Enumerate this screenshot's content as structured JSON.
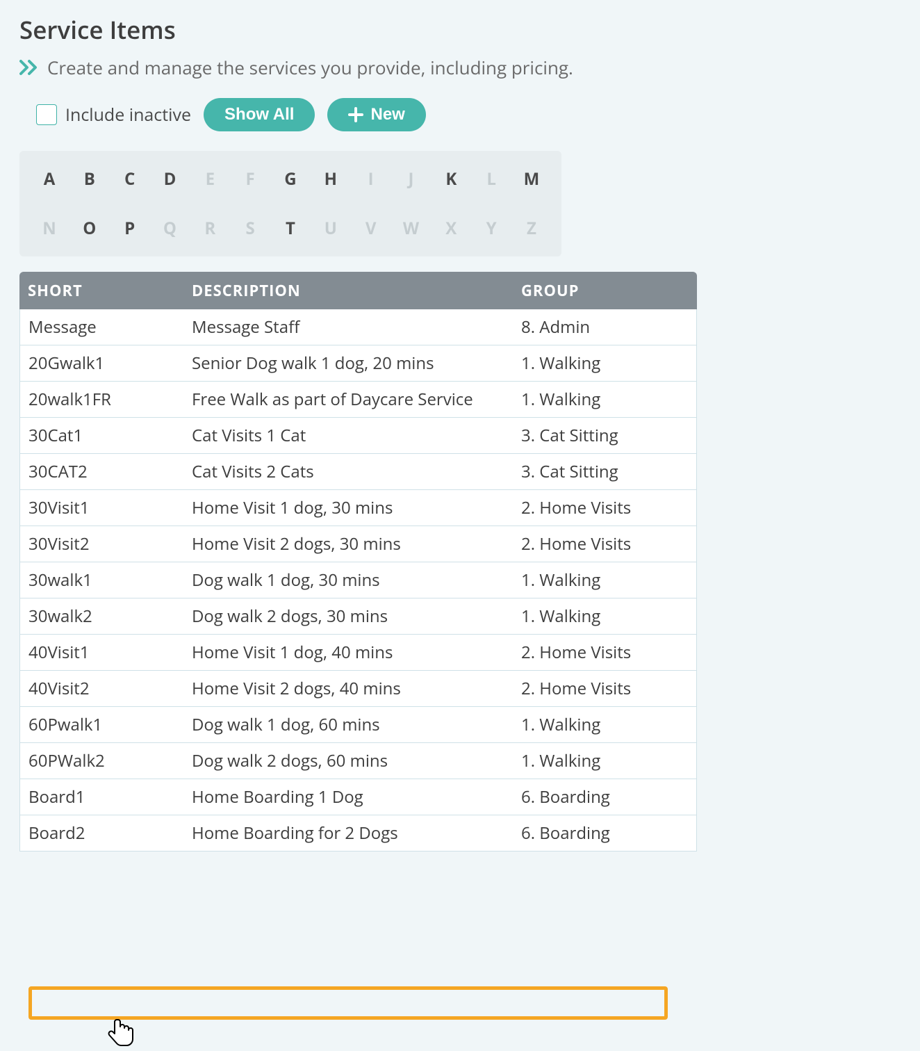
{
  "page": {
    "title": "Service Items",
    "subtitle": "Create and manage the services you provide, including pricing."
  },
  "controls": {
    "include_inactive_label": "Include inactive",
    "show_all_label": "Show All",
    "new_label": "New"
  },
  "alpha_filter": {
    "rows": [
      [
        {
          "letter": "A",
          "active": true
        },
        {
          "letter": "B",
          "active": true
        },
        {
          "letter": "C",
          "active": true
        },
        {
          "letter": "D",
          "active": true
        },
        {
          "letter": "E",
          "active": false
        },
        {
          "letter": "F",
          "active": false
        },
        {
          "letter": "G",
          "active": true
        },
        {
          "letter": "H",
          "active": true
        },
        {
          "letter": "I",
          "active": false
        },
        {
          "letter": "J",
          "active": false
        },
        {
          "letter": "K",
          "active": true
        },
        {
          "letter": "L",
          "active": false
        },
        {
          "letter": "M",
          "active": true
        }
      ],
      [
        {
          "letter": "N",
          "active": false
        },
        {
          "letter": "O",
          "active": true
        },
        {
          "letter": "P",
          "active": true
        },
        {
          "letter": "Q",
          "active": false
        },
        {
          "letter": "R",
          "active": false
        },
        {
          "letter": "S",
          "active": false
        },
        {
          "letter": "T",
          "active": true
        },
        {
          "letter": "U",
          "active": false
        },
        {
          "letter": "V",
          "active": false
        },
        {
          "letter": "W",
          "active": false
        },
        {
          "letter": "X",
          "active": false
        },
        {
          "letter": "Y",
          "active": false
        },
        {
          "letter": "Z",
          "active": false
        }
      ]
    ]
  },
  "table": {
    "headers": {
      "short": "SHORT",
      "description": "DESCRIPTION",
      "group": "GROUP"
    },
    "rows": [
      {
        "short": "Message",
        "description": "Message Staff",
        "group": "8. Admin"
      },
      {
        "short": "20Gwalk1",
        "description": "Senior Dog walk 1 dog, 20 mins",
        "group": "1. Walking"
      },
      {
        "short": "20walk1FR",
        "description": "Free Walk as part of Daycare Service",
        "group": "1. Walking"
      },
      {
        "short": "30Cat1",
        "description": "Cat Visits 1 Cat",
        "group": "3. Cat Sitting"
      },
      {
        "short": "30CAT2",
        "description": "Cat Visits 2 Cats",
        "group": "3. Cat Sitting"
      },
      {
        "short": "30Visit1",
        "description": "Home Visit 1 dog, 30 mins",
        "group": "2. Home Visits"
      },
      {
        "short": "30Visit2",
        "description": "Home Visit 2 dogs, 30 mins",
        "group": "2. Home Visits"
      },
      {
        "short": "30walk1",
        "description": "Dog walk 1 dog, 30 mins",
        "group": "1. Walking"
      },
      {
        "short": "30walk2",
        "description": "Dog walk 2 dogs, 30 mins",
        "group": "1. Walking"
      },
      {
        "short": "40Visit1",
        "description": "Home Visit 1 dog, 40 mins",
        "group": "2. Home Visits"
      },
      {
        "short": "40Visit2",
        "description": "Home Visit 2 dogs, 40 mins",
        "group": "2. Home Visits"
      },
      {
        "short": "60Pwalk1",
        "description": "Dog walk 1 dog, 60 mins",
        "group": "1. Walking"
      },
      {
        "short": "60PWalk2",
        "description": "Dog walk 2 dogs, 60 mins",
        "group": "1. Walking"
      },
      {
        "short": "Board1",
        "description": "Home Boarding 1 Dog",
        "group": "6. Boarding",
        "highlighted": true
      },
      {
        "short": "Board2",
        "description": "Home Boarding for 2 Dogs",
        "group": "6. Boarding"
      }
    ]
  },
  "icons": {
    "chevrons": "chevrons-right-icon",
    "plus": "plus-icon",
    "cursor": "hand-pointer-icon"
  },
  "colors": {
    "accent": "#46b6ab",
    "highlight": "#f5a623",
    "header_bg": "#838c93",
    "page_bg": "#f0f6f8"
  }
}
